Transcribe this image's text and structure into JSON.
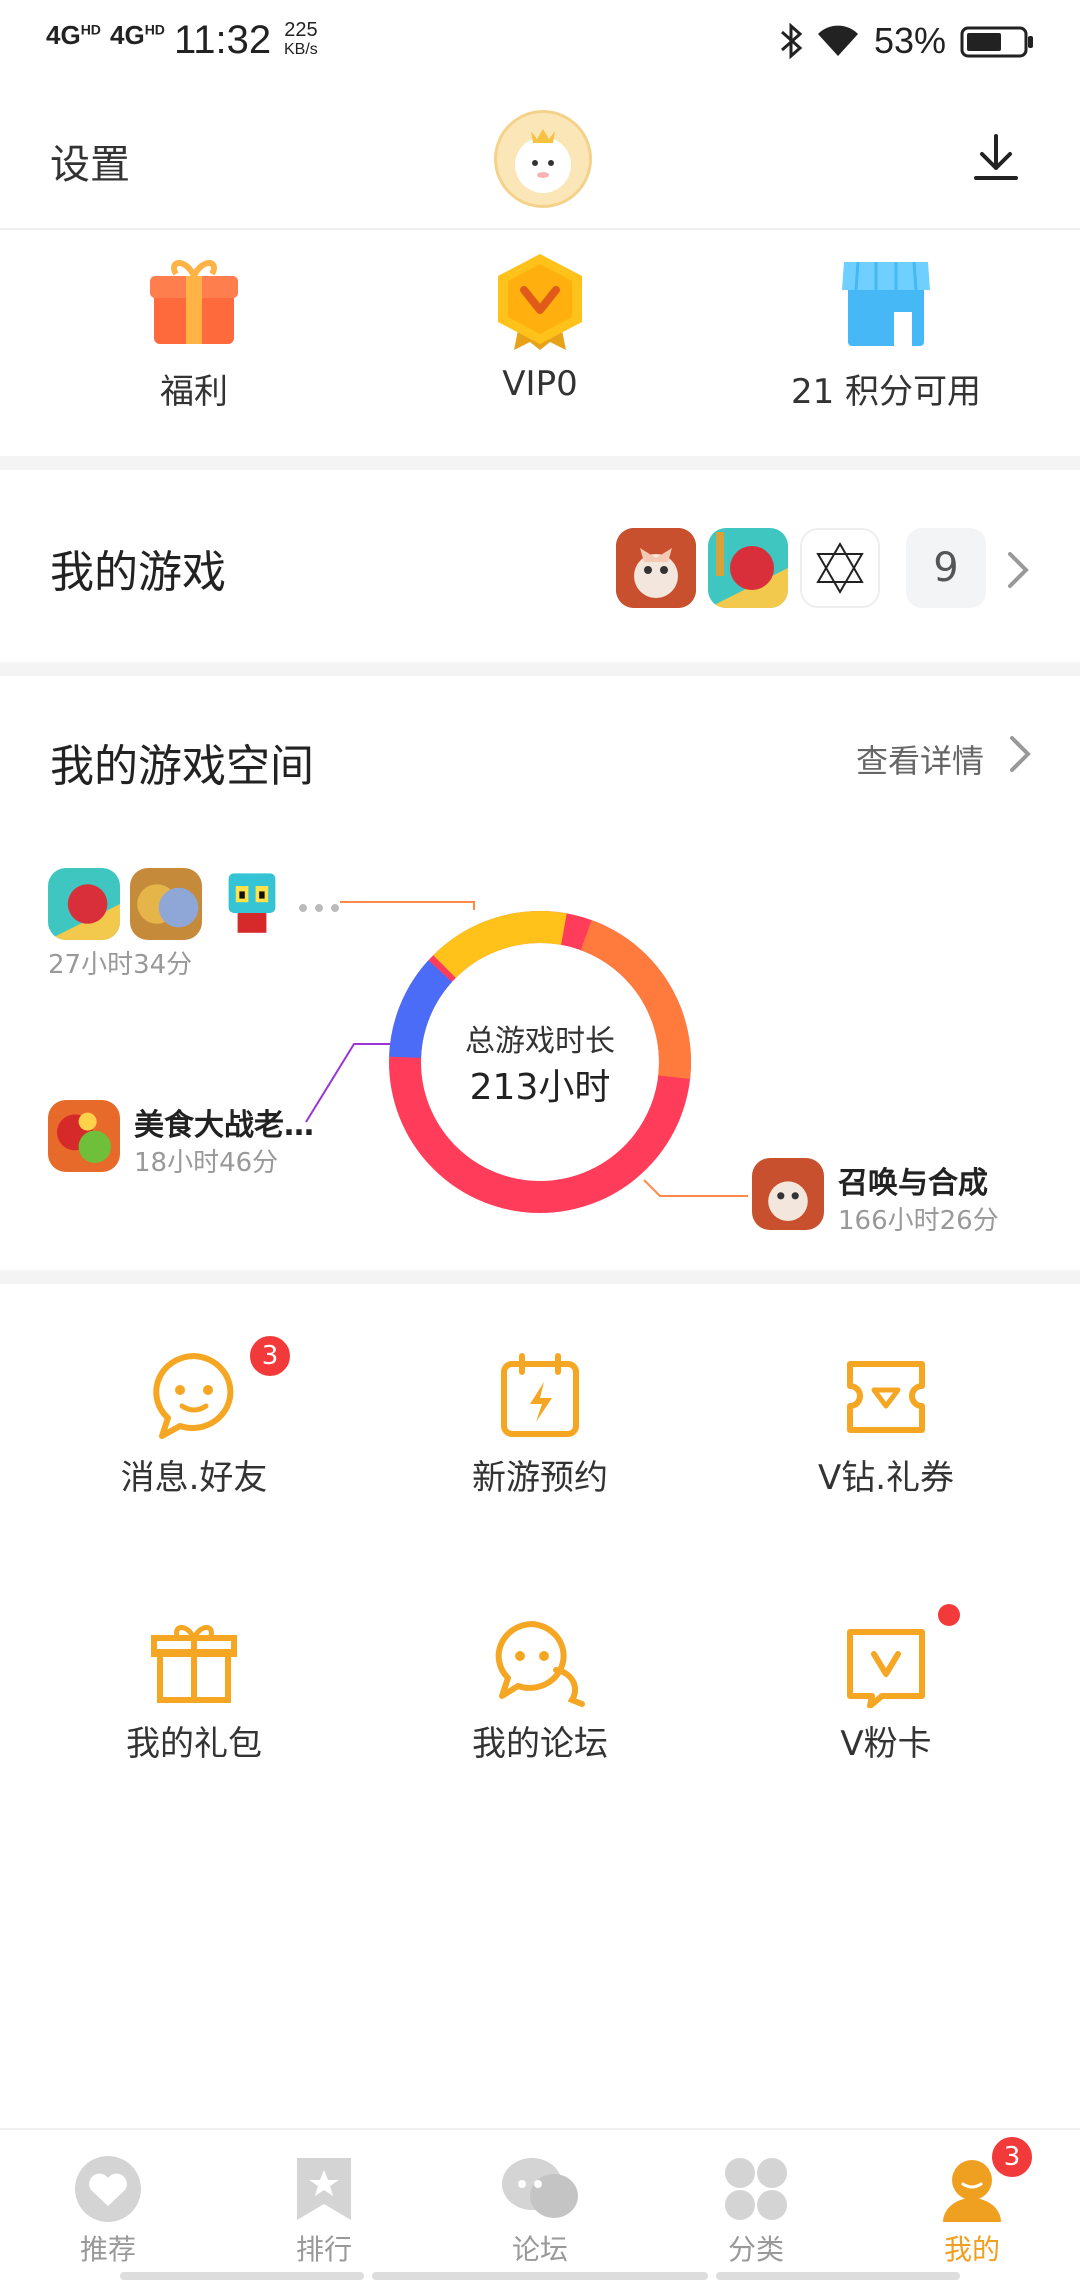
{
  "status_bar": {
    "signal_1": "4G",
    "signal_1_sup": "HD",
    "signal_2": "4G",
    "signal_2_sup": "HD",
    "time": "11:32",
    "speed_value": "225",
    "speed_unit": "KB/s",
    "battery": "53%"
  },
  "header": {
    "settings": "设置"
  },
  "quick_actions": [
    {
      "label": "福利",
      "icon": "gift-icon"
    },
    {
      "label": "VIP0",
      "icon": "vip-badge-icon"
    },
    {
      "label": "21 积分可用",
      "icon": "store-icon"
    }
  ],
  "my_games": {
    "title": "我的游戏",
    "count": "9"
  },
  "game_space": {
    "title": "我的游戏空间",
    "details_link": "查看详情",
    "others_time": "27小时34分",
    "game_a_name": "美食大战老…",
    "game_a_time": "18小时46分",
    "game_b_name": "召唤与合成",
    "game_b_time": "166小时26分",
    "total_label": "总游戏时长",
    "total_value": "213小时",
    "ring_colors": {
      "main": "#ff3d5a",
      "secondary": "#ff7a3d",
      "yellow": "#ffc21a",
      "blue": "#4a6cf7"
    }
  },
  "features": [
    {
      "label": "消息.好友",
      "icon": "chat-icon",
      "badge": "3"
    },
    {
      "label": "新游预约",
      "icon": "calendar-bolt-icon"
    },
    {
      "label": "V钻.礼券",
      "icon": "ticket-icon"
    },
    {
      "label": "我的礼包",
      "icon": "gift-box-icon"
    },
    {
      "label": "我的论坛",
      "icon": "forum-icon"
    },
    {
      "label": "V粉卡",
      "icon": "v-card-icon",
      "dot": true
    }
  ],
  "tabs": [
    {
      "label": "推荐",
      "icon": "heart-icon"
    },
    {
      "label": "排行",
      "icon": "ranking-icon"
    },
    {
      "label": "论坛",
      "icon": "forum-tab-icon"
    },
    {
      "label": "分类",
      "icon": "category-icon"
    },
    {
      "label": "我的",
      "icon": "me-icon",
      "badge": "3",
      "active": true
    }
  ],
  "colors": {
    "accent": "#f5a623",
    "active_tab": "#f0a020",
    "badge": "#f23a3a"
  }
}
